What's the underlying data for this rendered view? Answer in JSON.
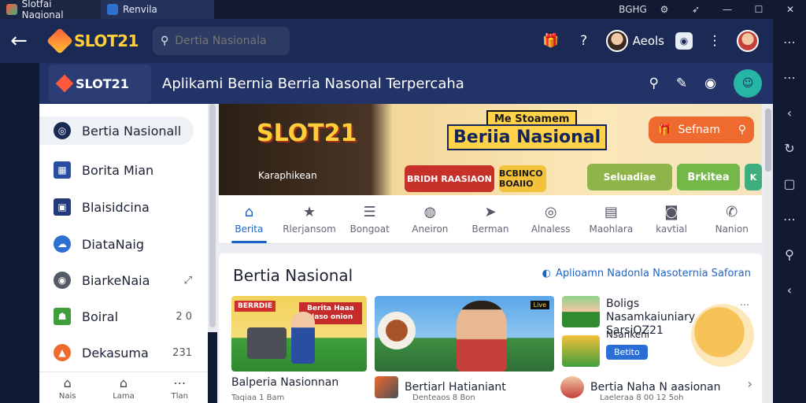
{
  "os": {
    "tabs": [
      {
        "label": "Slotfai Naqional"
      },
      {
        "label": "Renvila"
      }
    ],
    "tray_label": "BGHG"
  },
  "appbar": {
    "logo_text": "SLOT21",
    "search_placeholder": "Dertia Nasionala",
    "user_name": "Aeols"
  },
  "subbar": {
    "badge_text": "SLOT21",
    "title": "Aplikami Bernia Berria Nasonal Terpercaha"
  },
  "sidebar": {
    "items": [
      {
        "label": "Bertia Nasionall",
        "count": "",
        "color": "#1a2a55"
      },
      {
        "label": "Borita Mian",
        "count": "",
        "color": "#2b4fa0"
      },
      {
        "label": "Blaisidcina",
        "count": "",
        "color": "#233a7a"
      },
      {
        "label": "DiataNaig",
        "count": "",
        "color": "#2f6fd0"
      },
      {
        "label": "BiarkeNaia",
        "count": "",
        "color": "#555b66"
      },
      {
        "label": "Boiral",
        "count": "2 0",
        "color": "#3f9e3a"
      },
      {
        "label": "Dekasuma",
        "count": "231",
        "color": "#ef6a2e"
      }
    ],
    "bottom_nav": [
      {
        "label": "Nais"
      },
      {
        "label": "Lama"
      },
      {
        "label": "Tlan"
      }
    ]
  },
  "banner": {
    "brand": "SLOT21",
    "sub": "Karaphikean",
    "tag_small": "Me Stoamem",
    "headline": "Beriia Nasional",
    "pills": [
      "BRIDH RAASIAON",
      "BCBINCO BOAIIO",
      "Seluadiae",
      "Brkitea",
      "K"
    ],
    "cta": "Sefnam"
  },
  "tabs": [
    {
      "label": "Berita",
      "icon": "home-icon",
      "active": true
    },
    {
      "label": "Rlerjansom",
      "icon": "star-icon",
      "active": false
    },
    {
      "label": "Bongoat",
      "icon": "list-icon",
      "active": false
    },
    {
      "label": "Aneiron",
      "icon": "globe-icon",
      "active": false
    },
    {
      "label": "Berman",
      "icon": "send-icon",
      "active": false
    },
    {
      "label": "Alnaless",
      "icon": "target-icon",
      "active": false
    },
    {
      "label": "Maohlara",
      "icon": "doc-icon",
      "active": false
    },
    {
      "label": "kavtial",
      "icon": "camera-icon",
      "active": false
    },
    {
      "label": "Nanion",
      "icon": "phone-icon",
      "active": false
    }
  ],
  "section": {
    "title": "Bertia Nasional",
    "link": "Aplioamn Nadonla Nasoternia Saforan",
    "cards": [
      {
        "tag": "BERRDIE",
        "text": "Berita Haaa Naso onion"
      },
      {
        "tag": "Live"
      },
      {
        "title": "Boligs Nasamkaiuniary SarsiOZ21",
        "label": "Nsankeni",
        "button": "Betito"
      }
    ],
    "captions": [
      {
        "title": "Balperia Nasionnan",
        "meta": "Taqiaa 1 Bam"
      },
      {
        "title": "Bertiarl Hatianiant",
        "meta": "Denteaos 8 Bon"
      },
      {
        "title": "Bertia Naha N aasionan",
        "meta": "Laeleraa 8 00 12 5oh"
      }
    ]
  },
  "colors": {
    "header_bg": "#1a2a55",
    "subbar_bg": "#223467",
    "accent": "#1e64c8",
    "cta_orange": "#ef6a2e"
  }
}
